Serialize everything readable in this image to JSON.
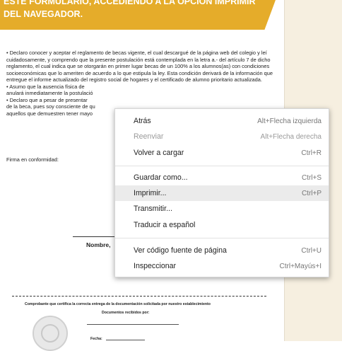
{
  "document": {
    "banner": {
      "line1": "ESTE FORMULARIO, ACCEDIENDO A LA OPCIÓN IMPRIMIR",
      "line2": "DEL NAVEGADOR."
    },
    "paragraphs": [
      "•     Declaro conocer y aceptar el reglamento de becas vigente, el cual descargué de la página web del colegio y leí cuidadosamente, y comprendo que la presente postulación está contemplada en la letra a.- del artículo 7 de dicho reglamento, el cual indica que se otorgarán en primer lugar becas de un 100% a los alumnos(as) con condiciones socioeconómicas que lo ameriten de acuerdo a lo que estipula la ley. Esta condición derivará de la información que entregue el informe actualizado del registro social de hogares y el certificado de alumno prioritario actualizada.",
      "•     Asumo que la ausencia física de",
      "anulará inmediatamente la postulació",
      "•     Declaro que a pesar de presentar",
      "de la beca, pues soy consciente de qu",
      "aquellos que demuestren tener mayo"
    ],
    "firma": "Firma en conformidad:",
    "nombre": "Nombre,",
    "comprobante": "Comprobante que certifica la correcta entrega de la documentación solicitada por nuestro establecimiento",
    "documentos": "Documentos recibidos por:",
    "fecha": "Fecha:"
  },
  "context_menu": {
    "items": [
      {
        "label": "Atrás",
        "shortcut": "Alt+Flecha izquierda",
        "disabled": false
      },
      {
        "label": "Reenviar",
        "shortcut": "Alt+Flecha derecha",
        "disabled": true
      },
      {
        "label": "Volver a cargar",
        "shortcut": "Ctrl+R",
        "disabled": false
      },
      {
        "label": "Guardar como...",
        "shortcut": "Ctrl+S",
        "disabled": false
      },
      {
        "label": "Imprimir...",
        "shortcut": "Ctrl+P",
        "disabled": false,
        "highlighted": true
      },
      {
        "label": "Transmitir...",
        "shortcut": "",
        "disabled": false
      },
      {
        "label": "Traducir a español",
        "shortcut": "",
        "disabled": false
      },
      {
        "label": "Ver código fuente de página",
        "shortcut": "Ctrl+U",
        "disabled": false
      },
      {
        "label": "Inspeccionar",
        "shortcut": "Ctrl+Mayús+I",
        "disabled": false
      }
    ]
  },
  "colors": {
    "banner": "#e5ac2a",
    "sidebar": "#f6efe0",
    "menu_highlight": "#ebebeb"
  }
}
